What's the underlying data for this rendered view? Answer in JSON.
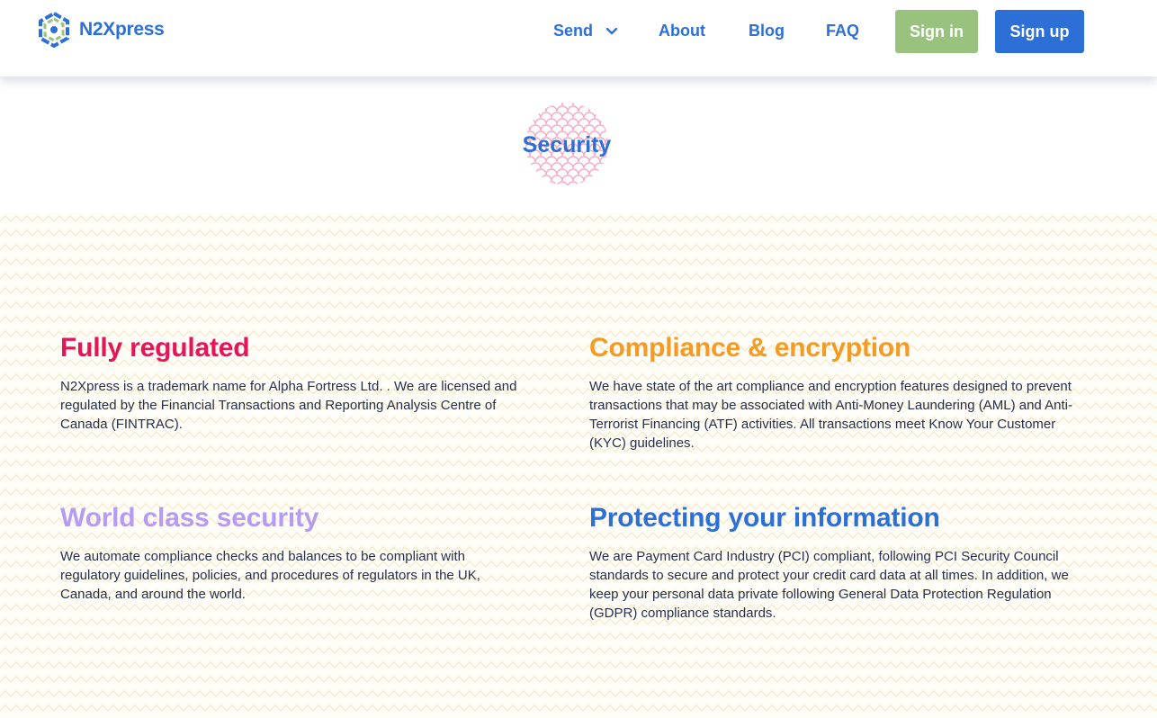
{
  "brand": {
    "name": "N2Xpress",
    "logo_icon": "hexagon-logo-icon",
    "color": "#2c6fd6"
  },
  "nav": {
    "items": [
      {
        "label": "Send",
        "has_dropdown": true
      },
      {
        "label": "About"
      },
      {
        "label": "Blog"
      },
      {
        "label": "FAQ"
      }
    ],
    "sign_in": "Sign in",
    "sign_up": "Sign up"
  },
  "hero": {
    "title": "Security"
  },
  "sections": [
    {
      "title": "Fully regulated",
      "color": "#e8145a",
      "body": "N2Xpress is a trademark name for Alpha Fortress Ltd. . We are licensed and regulated by the Financial Transactions and Reporting Analysis Centre of Canada (FINTRAC)."
    },
    {
      "title": "Compliance & encryption",
      "color": "#f59a23",
      "body": "We have state of the art compliance and encryption features designed to prevent transactions that may be associated with Anti-Money Laundering (AML) and Anti-Terrorist Financing (ATF) activities. All transactions meet Know Your Customer (KYC) guidelines."
    },
    {
      "title": "World class security",
      "color": "#b79bf2",
      "body": "We automate compliance checks and balances to be compliant with regulatory guidelines, policies, and procedures of regulators in the UK, Canada, and around the world."
    },
    {
      "title": "Protecting your information",
      "color": "#2c6fd6",
      "body": "We are Payment Card Industry (PCI) compliant, following PCI Security Council standards to secure and protect your credit card data at all times. In addition, we keep your personal data private following General Data Protection Regulation (GDPR) compliance standards."
    }
  ]
}
